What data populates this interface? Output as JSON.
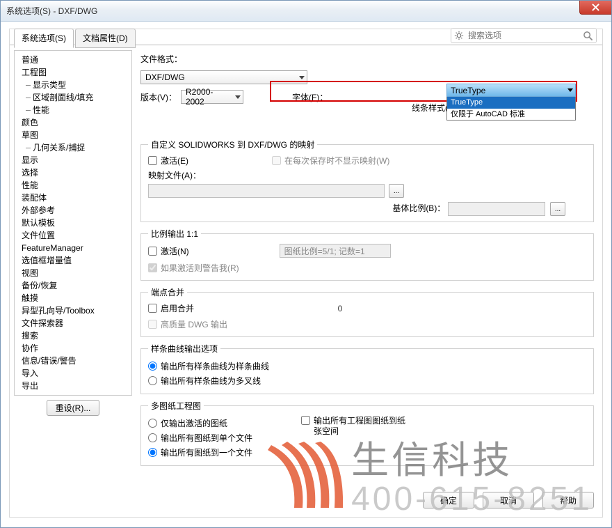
{
  "window": {
    "title": "系统选项(S) - DXF/DWG"
  },
  "tabs": {
    "active": "系统选项(S)",
    "inactive": "文档属性(D)"
  },
  "search": {
    "placeholder": "搜索选项"
  },
  "tree": {
    "items": [
      {
        "t": "普通",
        "l": 0
      },
      {
        "t": "工程图",
        "l": 0
      },
      {
        "t": "显示类型",
        "l": 1
      },
      {
        "t": "区域剖面线/填充",
        "l": 1
      },
      {
        "t": "性能",
        "l": 1
      },
      {
        "t": "颜色",
        "l": 0
      },
      {
        "t": "草图",
        "l": 0
      },
      {
        "t": "几何关系/捕捉",
        "l": 1
      },
      {
        "t": "显示",
        "l": 0
      },
      {
        "t": "选择",
        "l": 0
      },
      {
        "t": "性能",
        "l": 0
      },
      {
        "t": "装配体",
        "l": 0
      },
      {
        "t": "外部参考",
        "l": 0
      },
      {
        "t": "默认模板",
        "l": 0
      },
      {
        "t": "文件位置",
        "l": 0
      },
      {
        "t": "FeatureManager",
        "l": 0
      },
      {
        "t": "选值框增量值",
        "l": 0
      },
      {
        "t": "视图",
        "l": 0
      },
      {
        "t": "备份/恢复",
        "l": 0
      },
      {
        "t": "触摸",
        "l": 0
      },
      {
        "t": "异型孔向导/Toolbox",
        "l": 0
      },
      {
        "t": "文件探索器",
        "l": 0
      },
      {
        "t": "搜索",
        "l": 0
      },
      {
        "t": "协作",
        "l": 0
      },
      {
        "t": "信息/错误/警告",
        "l": 0
      },
      {
        "t": "导入",
        "l": 0
      },
      {
        "t": "导出",
        "l": 0,
        "sel": true
      }
    ]
  },
  "reset": "重设(R)...",
  "right": {
    "fileformat_lbl": "文件格式：",
    "fileformat_val": "DXF/DWG",
    "version_lbl": "版本(V)：",
    "version_val": "R2000-2002",
    "font_lbl": "字体(F)：",
    "font_val": "TrueType",
    "font_opts": [
      "TrueType",
      "仅限于 AutoCAD 标准"
    ],
    "linestyle_lbl": "线条样式(L)：",
    "grp_map": {
      "legend": "自定义 SOLIDWORKS 到 DXF/DWG 的映射",
      "activate": "激活(E)",
      "nosave": "在每次保存时不显示映射(W)",
      "mapfile": "映射文件(A)：",
      "basescale": "基体比例(B)："
    },
    "grp_ratio": {
      "legend": "比例输出 1:1",
      "activate": "激活(N)",
      "warn": "如果激活则警告我(R)",
      "dd": "图纸比例=5/1; 记数=1"
    },
    "grp_end": {
      "legend": "端点合并",
      "enable": "启用合并",
      "val": "0",
      "hq": "高质量 DWG 输出"
    },
    "grp_spline": {
      "legend": "样条曲线输出选项",
      "r1": "输出所有样条曲线为样条曲线",
      "r2": "输出所有样条曲线为多叉线"
    },
    "grp_multi": {
      "legend": "多图纸工程图",
      "r1": "仅输出激活的图纸",
      "r2": "输出所有图纸到单个文件",
      "r3": "输出所有图纸到一个文件",
      "chk": "输出所有工程图图纸到纸张空间"
    }
  },
  "buttons": {
    "ok": "确定",
    "cancel": "取消",
    "help": "帮助"
  },
  "watermark": {
    "txt": "生信科技",
    "phone": "400-615-8251"
  }
}
